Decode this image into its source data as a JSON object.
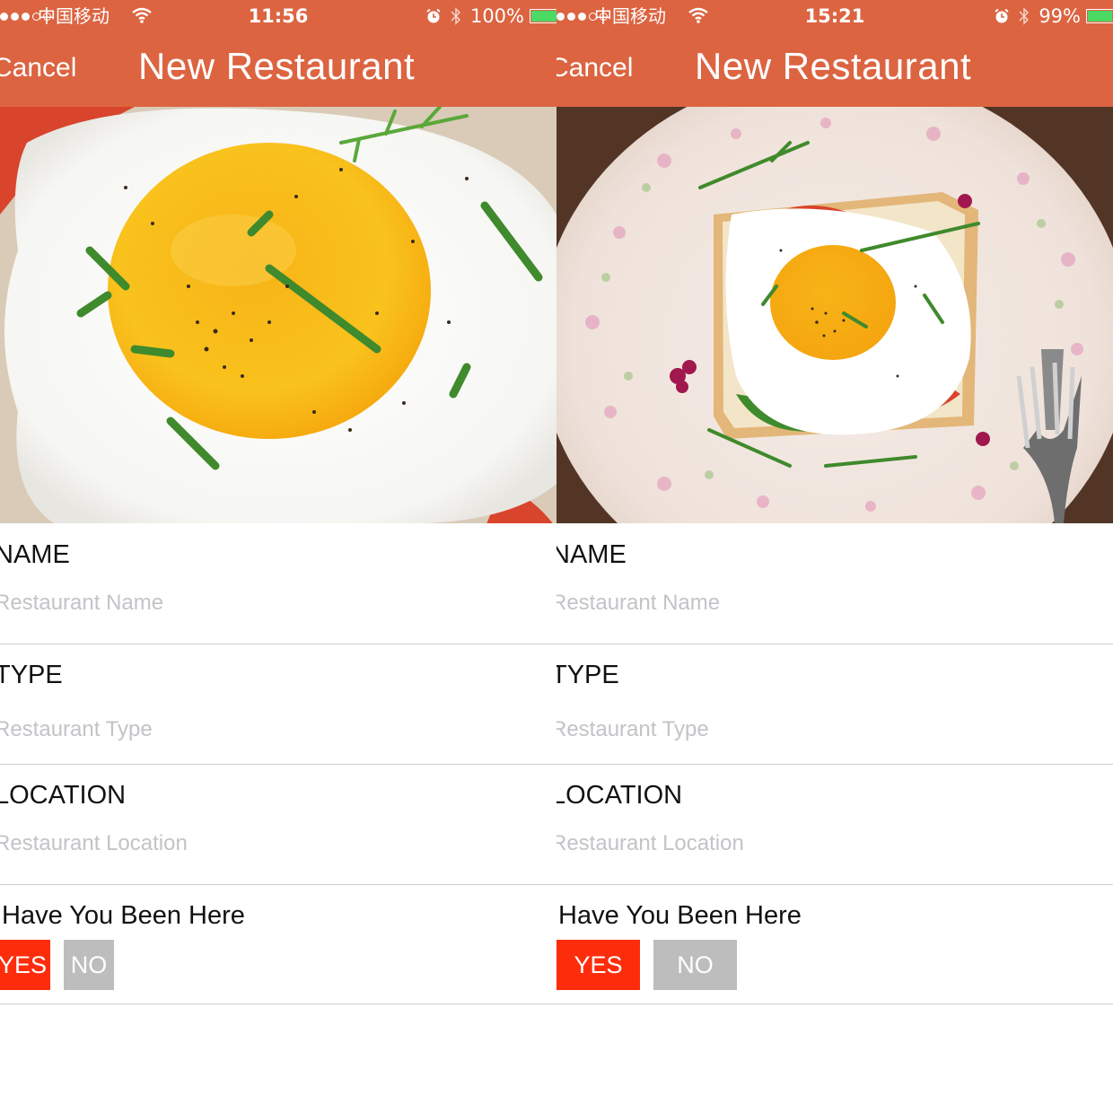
{
  "colors": {
    "header_bg": "#dc6441",
    "yes_button": "#fd2d0c",
    "no_button": "#bdbdbd",
    "placeholder": "#c3c3c8",
    "battery": "#4cd964"
  },
  "screens": [
    {
      "status": {
        "carrier": "中国移动",
        "time": "11:56",
        "battery": "100%"
      },
      "nav": {
        "cancel": "Cancel",
        "title": "New Restaurant"
      },
      "photo": "fried-egg-closeup",
      "form": {
        "name_label": "NAME",
        "name_placeholder": "Restaurant Name",
        "type_label": "TYPE",
        "type_placeholder": "Restaurant Type",
        "location_label": "LOCATION",
        "location_placeholder": "Restaurant Location",
        "been_label": "Have You Been Here",
        "yes": "YES",
        "no": "NO"
      }
    },
    {
      "status": {
        "carrier": "中国移动",
        "time": "15:21",
        "battery": "99%"
      },
      "nav": {
        "cancel": "Cancel",
        "title": "New Restaurant"
      },
      "photo": "egg-toast-on-floral-plate",
      "form": {
        "name_label": "NAME",
        "name_placeholder": "Restaurant Name",
        "type_label": "TYPE",
        "type_placeholder": "Restaurant Type",
        "location_label": "LOCATION",
        "location_placeholder": "Restaurant Location",
        "been_label": "Have You Been Here",
        "yes": "YES",
        "no": "NO"
      }
    }
  ]
}
